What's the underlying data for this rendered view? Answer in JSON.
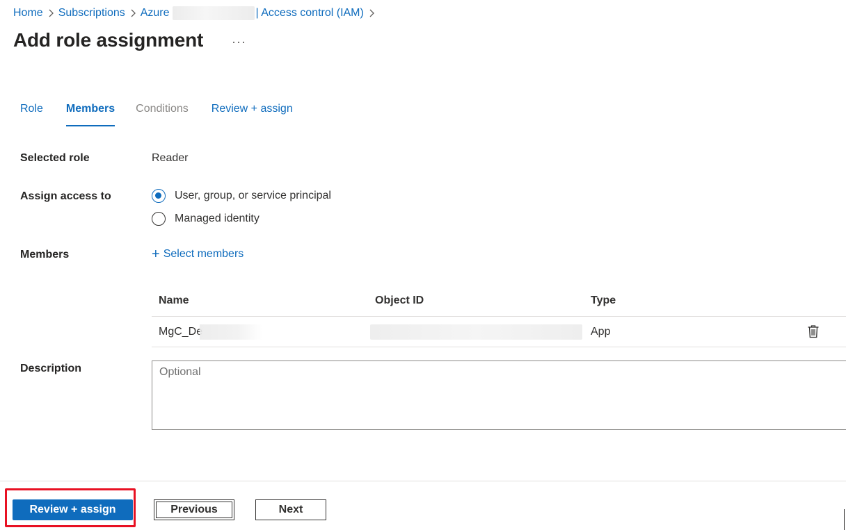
{
  "breadcrumb": {
    "home": "Home",
    "subscriptions": "Subscriptions",
    "azure": "Azure",
    "access_control": "| Access control (IAM)"
  },
  "page": {
    "title": "Add role assignment",
    "more_label": "···"
  },
  "tabs": [
    {
      "label": "Role",
      "state": "normal"
    },
    {
      "label": "Members",
      "state": "active"
    },
    {
      "label": "Conditions",
      "state": "disabled"
    },
    {
      "label": "Review + assign",
      "state": "normal"
    }
  ],
  "form": {
    "selected_role_label": "Selected role",
    "selected_role_value": "Reader",
    "assign_access_label": "Assign access to",
    "assign_options": [
      {
        "label": "User, group, or service principal",
        "checked": true
      },
      {
        "label": "Managed identity",
        "checked": false
      }
    ],
    "members_label": "Members",
    "select_members_label": "Select members",
    "description_label": "Description",
    "description_placeholder": "Optional",
    "description_value": ""
  },
  "members_table": {
    "columns": [
      "Name",
      "Object ID",
      "Type"
    ],
    "rows": [
      {
        "name": "MgC_De",
        "object_id": "",
        "type": "App"
      }
    ]
  },
  "footer": {
    "review_assign_label": "Review + assign",
    "previous_label": "Previous",
    "next_label": "Next"
  },
  "colors": {
    "accent": "#0f6cbd",
    "highlight": "#e81123",
    "disabled_text": "#8a8886"
  },
  "icons": {
    "breadcrumb_separator": "chevron-right-icon",
    "add": "plus-icon",
    "remove_member": "trash-icon",
    "radio_selected": "radio-checked-icon",
    "radio_unselected": "radio-unchecked-icon"
  }
}
